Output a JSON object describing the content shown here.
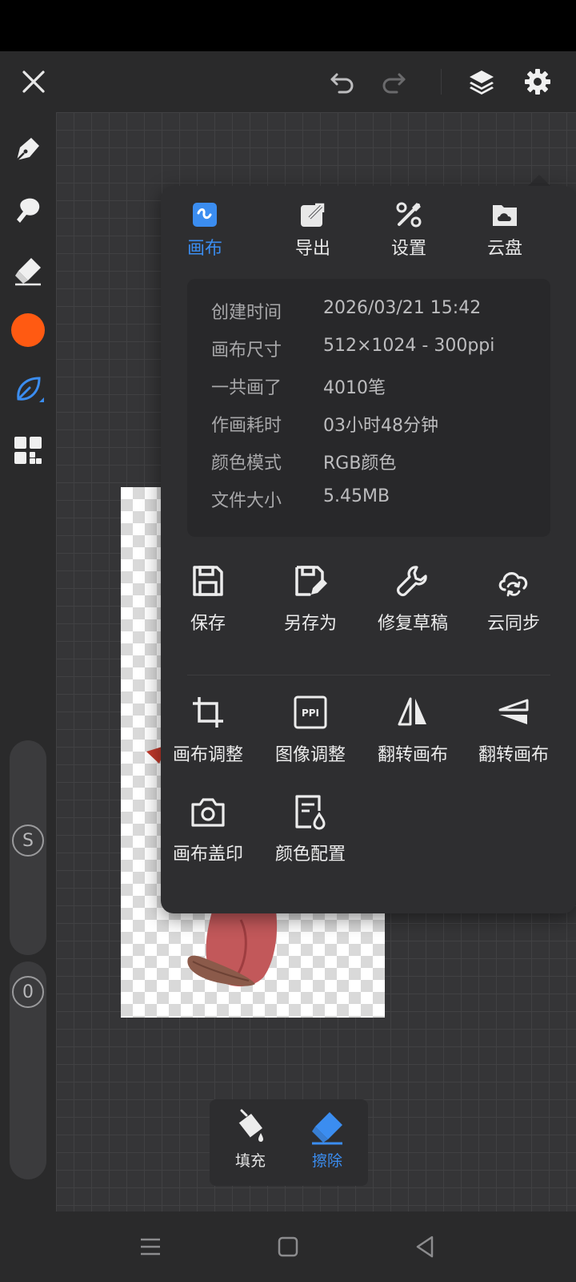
{
  "colors": {
    "accent": "#3b8df0",
    "brush_color": "#ff5a12",
    "panel_bg": "#2e2e30",
    "workspace_bg": "#353537"
  },
  "toolbar": {
    "close_icon": "close-icon",
    "undo_icon": "undo-icon",
    "redo_icon": "redo-icon",
    "layers_icon": "layers-icon",
    "settings_icon": "gear-icon"
  },
  "left_tools": [
    {
      "name": "brush",
      "icon": "pen-icon"
    },
    {
      "name": "smudge",
      "icon": "smudge-icon"
    },
    {
      "name": "eraser",
      "icon": "eraser-icon"
    },
    {
      "name": "color",
      "icon": "color-swatch"
    },
    {
      "name": "leaf-brush",
      "icon": "leaf-icon"
    },
    {
      "name": "grid-menu",
      "icon": "grid-icon"
    }
  ],
  "sliders": {
    "size_label": "S",
    "opacity_label": "0"
  },
  "popup": {
    "tabs": [
      {
        "label": "画布",
        "icon": "canvas-icon"
      },
      {
        "label": "导出",
        "icon": "export-icon"
      },
      {
        "label": "设置",
        "icon": "tools-icon"
      },
      {
        "label": "云盘",
        "icon": "cloud-drive-icon"
      }
    ],
    "info": [
      {
        "key": "创建时间",
        "value": "2026/03/21 15:42"
      },
      {
        "key": "画布尺寸",
        "value": "512×1024 - 300ppi"
      },
      {
        "key": "一共画了",
        "value": "4010笔"
      },
      {
        "key": "作画耗时",
        "value": "03小时48分钟"
      },
      {
        "key": "颜色模式",
        "value": "RGB颜色"
      },
      {
        "key": "文件大小",
        "value": "5.45MB"
      }
    ],
    "actions_row1": [
      {
        "label": "保存",
        "icon": "save-icon"
      },
      {
        "label": "另存为",
        "icon": "save-as-icon"
      },
      {
        "label": "修复草稿",
        "icon": "wrench-icon"
      },
      {
        "label": "云同步",
        "icon": "cloud-sync-icon"
      }
    ],
    "actions_row2": [
      {
        "label": "画布调整",
        "icon": "crop-icon"
      },
      {
        "label": "图像调整",
        "icon": "ppi-icon"
      },
      {
        "label": "翻转画布",
        "icon": "flip-horizontal-icon"
      },
      {
        "label": "翻转画布",
        "icon": "flip-vertical-icon"
      }
    ],
    "actions_row3": [
      {
        "label": "画布盖印",
        "icon": "camera-icon"
      },
      {
        "label": "颜色配置",
        "icon": "color-profile-icon"
      }
    ]
  },
  "bottom_panel": {
    "fill_label": "填充",
    "erase_label": "擦除"
  }
}
